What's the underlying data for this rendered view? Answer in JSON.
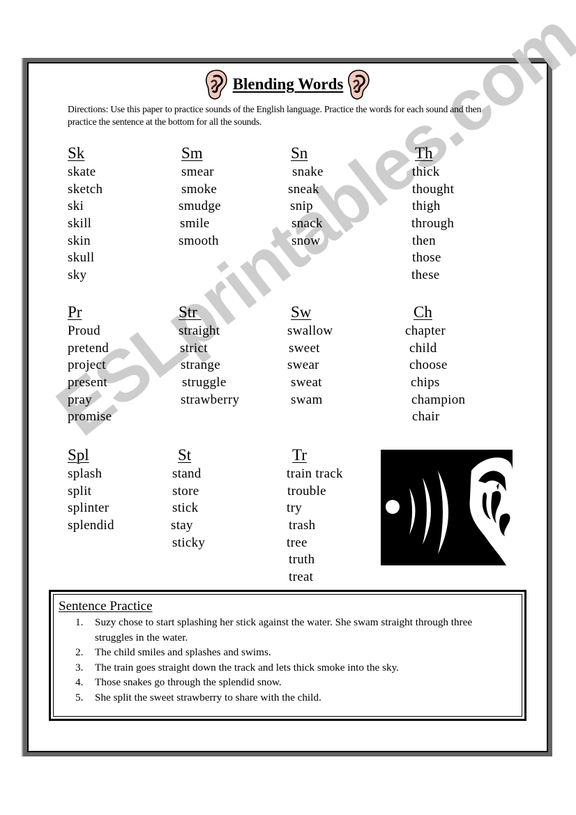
{
  "title": "Blending Words",
  "directions": "Directions: Use this paper to practice sounds of the English language.  Practice the words for each sound and then practice the sentence at the bottom for all the sounds.",
  "watermark": "ESLprintables.com",
  "icons": {
    "title_left": "ear-icon",
    "title_right": "ear-icon",
    "illustration": "ear-sound-waves-icon"
  },
  "word_groups": [
    {
      "sound": "Sk",
      "words": [
        "skate",
        "sketch",
        "ski",
        "skill",
        "skin",
        "skull",
        "sky"
      ]
    },
    {
      "sound": "Sm",
      "words": [
        "smear",
        "smoke",
        "smudge",
        "smile",
        "smooth"
      ]
    },
    {
      "sound": "Sn",
      "words": [
        "snake",
        "sneak",
        "snip",
        "snack",
        "snow"
      ]
    },
    {
      "sound": "Th",
      "words": [
        "thick",
        "thought",
        "thigh",
        "through",
        "then",
        "those",
        "these"
      ]
    },
    {
      "sound": "Pr",
      "words": [
        "Proud",
        "pretend",
        "project",
        "present",
        "pray",
        "promise"
      ]
    },
    {
      "sound": "Str ",
      "words": [
        "straight",
        "strict",
        "strange",
        "struggle",
        "strawberry"
      ]
    },
    {
      "sound": "Sw",
      "words": [
        "swallow",
        "sweet",
        "swear",
        "sweat",
        "swam"
      ]
    },
    {
      "sound": "Ch",
      "words": [
        "chapter",
        "child",
        "choose",
        "chips",
        "champion",
        "chair"
      ]
    },
    {
      "sound": "Spl",
      "words": [
        "splash",
        "split",
        "splinter",
        "splendid"
      ]
    },
    {
      "sound": "St",
      "words": [
        "stand",
        "store",
        "stick",
        "stay",
        "sticky"
      ]
    },
    {
      "sound": "Tr",
      "words": [
        "train track",
        "trouble",
        "try",
        "trash",
        "tree",
        "truth",
        "treat"
      ]
    }
  ],
  "sentence_practice": {
    "title": "Sentence Practice",
    "sentences": [
      {
        "num": "1.",
        "text": "Suzy chose to start splashing her stick against the water. She swam straight through three struggles in the water."
      },
      {
        "num": "2.",
        "text": "The child smiles and splashes and swims."
      },
      {
        "num": "3.",
        "text": "The train goes straight down the track and lets thick smoke into the sky."
      },
      {
        "num": "4.",
        "text": "Those snakes go through the splendid snow."
      },
      {
        "num": "5.",
        "text": "She split the sweet strawberry to share with the child."
      }
    ]
  },
  "colors": {
    "frame_gray": "#646464",
    "watermark_gray": "#cbcbcb",
    "ear_skin": "#f2c9bd"
  }
}
